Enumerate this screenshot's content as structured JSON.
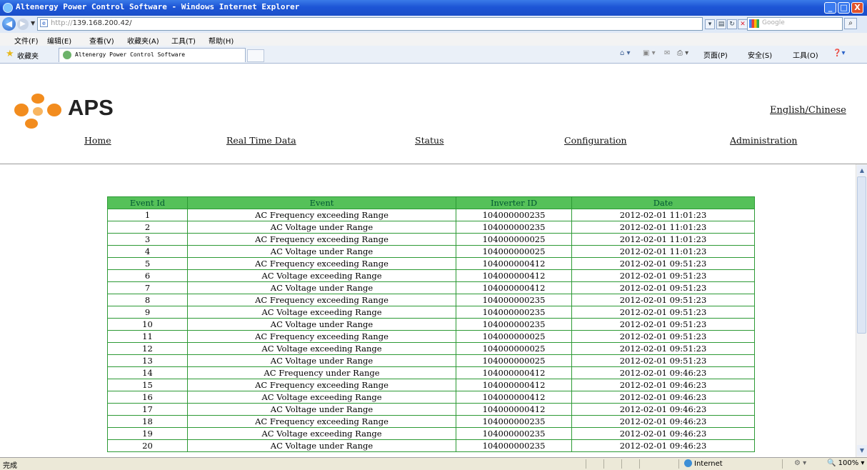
{
  "window": {
    "title": "Altenergy Power Control Software - Windows Internet Explorer",
    "controls": {
      "minimize": "_",
      "maximize": "□",
      "close": "X"
    }
  },
  "addressbar": {
    "protocol": "http://",
    "host": "139.168.200.42/",
    "search_placeholder": "Google"
  },
  "menu": [
    "文件(F)",
    "编辑(E)",
    "查看(V)",
    "收藏夹(A)",
    "工具(T)",
    "帮助(H)"
  ],
  "favorites": {
    "label": "收藏夹"
  },
  "tab": {
    "title": "Altenergy Power Control Software"
  },
  "commandbar": [
    "页面(P)",
    "安全(S)",
    "工具(O)"
  ],
  "page": {
    "brand": "APS",
    "language_link": "English/Chinese",
    "nav": [
      "Home",
      "Real Time Data",
      "Status",
      "Configuration",
      "Administration"
    ],
    "table": {
      "headers": [
        "Event Id",
        "Event",
        "Inverter ID",
        "Date"
      ],
      "rows": [
        [
          "1",
          "AC Frequency exceeding Range",
          "104000000235",
          "2012-02-01 11:01:23"
        ],
        [
          "2",
          "AC Voltage under Range",
          "104000000235",
          "2012-02-01 11:01:23"
        ],
        [
          "3",
          "AC Frequency exceeding Range",
          "104000000025",
          "2012-02-01 11:01:23"
        ],
        [
          "4",
          "AC Voltage under Range",
          "104000000025",
          "2012-02-01 11:01:23"
        ],
        [
          "5",
          "AC Frequency exceeding Range",
          "104000000412",
          "2012-02-01 09:51:23"
        ],
        [
          "6",
          "AC Voltage exceeding Range",
          "104000000412",
          "2012-02-01 09:51:23"
        ],
        [
          "7",
          "AC Voltage under Range",
          "104000000412",
          "2012-02-01 09:51:23"
        ],
        [
          "8",
          "AC Frequency exceeding Range",
          "104000000235",
          "2012-02-01 09:51:23"
        ],
        [
          "9",
          "AC Voltage exceeding Range",
          "104000000235",
          "2012-02-01 09:51:23"
        ],
        [
          "10",
          "AC Voltage under Range",
          "104000000235",
          "2012-02-01 09:51:23"
        ],
        [
          "11",
          "AC Frequency exceeding Range",
          "104000000025",
          "2012-02-01 09:51:23"
        ],
        [
          "12",
          "AC Voltage exceeding Range",
          "104000000025",
          "2012-02-01 09:51:23"
        ],
        [
          "13",
          "AC Voltage under Range",
          "104000000025",
          "2012-02-01 09:51:23"
        ],
        [
          "14",
          "AC Frequency under Range",
          "104000000412",
          "2012-02-01 09:46:23"
        ],
        [
          "15",
          "AC Frequency exceeding Range",
          "104000000412",
          "2012-02-01 09:46:23"
        ],
        [
          "16",
          "AC Voltage exceeding Range",
          "104000000412",
          "2012-02-01 09:46:23"
        ],
        [
          "17",
          "AC Voltage under Range",
          "104000000412",
          "2012-02-01 09:46:23"
        ],
        [
          "18",
          "AC Frequency exceeding Range",
          "104000000235",
          "2012-02-01 09:46:23"
        ],
        [
          "19",
          "AC Voltage exceeding Range",
          "104000000235",
          "2012-02-01 09:46:23"
        ],
        [
          "20",
          "AC Voltage under Range",
          "104000000235",
          "2012-02-01 09:46:23"
        ]
      ]
    }
  },
  "statusbar": {
    "status": "完成",
    "zone": "Internet",
    "zoom": "100%"
  },
  "colors": {
    "table_header": "#55c159",
    "table_border": "#2d9a35",
    "logo_orange": "#f28c1e"
  }
}
